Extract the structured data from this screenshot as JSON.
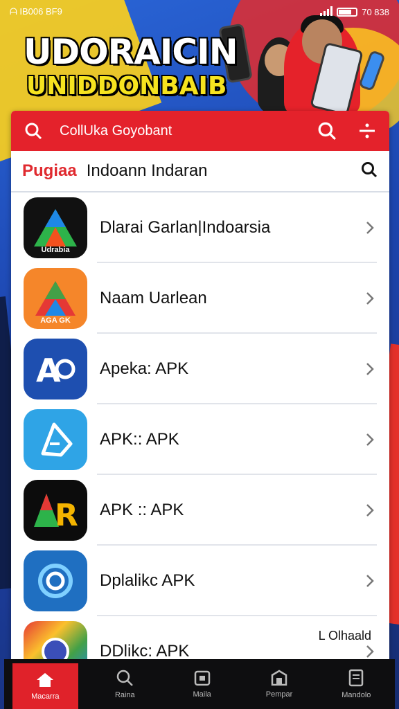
{
  "status_bar": {
    "left": "ᗩ IB006 BF9",
    "right": "70 838"
  },
  "hero": {
    "title": "UDORAICIN",
    "subtitle": "UNIDDONBAIB"
  },
  "card": {
    "header_title": "CollUka Goyobant",
    "tag": "Pugiaa",
    "subtitle": "Indoann Indaran"
  },
  "apps": [
    {
      "label": "Dlarai Garlan|Indoarsia",
      "icon": "green-blue-triangle-icon",
      "icon_text": "Udrabia"
    },
    {
      "label": "Naam Uarlean",
      "icon": "orange-triangle-icon",
      "icon_text": "AGA GK"
    },
    {
      "label": "Apeka: APK",
      "icon": "blue-a-icon",
      "icon_text": ""
    },
    {
      "label": "APK:: APK",
      "icon": "light-blue-a-icon",
      "icon_text": ""
    },
    {
      "label": "APK :: APK",
      "icon": "black-ar-icon",
      "icon_text": ""
    },
    {
      "label": "Dplalikc APK",
      "icon": "blue-camera-icon",
      "icon_text": ""
    },
    {
      "label": "DDlikc: APK",
      "icon": "multicolor-icon",
      "icon_text": "",
      "extra": "L Olhaald"
    }
  ],
  "bottom_nav": [
    {
      "label": "Macarra",
      "icon": "home-icon",
      "active": true
    },
    {
      "label": "Raina",
      "icon": "search-icon",
      "active": false
    },
    {
      "label": "Maila",
      "icon": "calendar-icon",
      "active": false
    },
    {
      "label": "Pempar",
      "icon": "store-icon",
      "active": false
    },
    {
      "label": "Mandolo",
      "icon": "document-icon",
      "active": false
    }
  ]
}
